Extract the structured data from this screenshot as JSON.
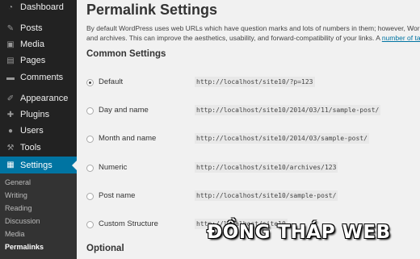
{
  "sidebar": {
    "items": [
      {
        "label": "Dashboard",
        "icon": "dashboard-icon",
        "glyph": "◔"
      },
      {
        "label": "Posts",
        "icon": "posts-icon",
        "glyph": "✎"
      },
      {
        "label": "Media",
        "icon": "media-icon",
        "glyph": "▣"
      },
      {
        "label": "Pages",
        "icon": "pages-icon",
        "glyph": "▤"
      },
      {
        "label": "Comments",
        "icon": "comments-icon",
        "glyph": "▬"
      },
      {
        "label": "Appearance",
        "icon": "appearance-icon",
        "glyph": "✐"
      },
      {
        "label": "Plugins",
        "icon": "plugins-icon",
        "glyph": "✚"
      },
      {
        "label": "Users",
        "icon": "users-icon",
        "glyph": "●"
      },
      {
        "label": "Tools",
        "icon": "tools-icon",
        "glyph": "⚒"
      },
      {
        "label": "Settings",
        "icon": "settings-icon",
        "glyph": "▦",
        "active": true
      }
    ],
    "submenu": [
      {
        "label": "General"
      },
      {
        "label": "Writing"
      },
      {
        "label": "Reading"
      },
      {
        "label": "Discussion"
      },
      {
        "label": "Media"
      },
      {
        "label": "Permalinks",
        "current": true
      }
    ]
  },
  "main": {
    "title": "Permalink Settings",
    "description_line1": "By default WordPress uses web URLs which have question marks and lots of numbers in them; however, WordPress",
    "description_line2_text": "and archives. This can improve the aesthetics, usability, and forward-compatibility of your links. A ",
    "description_link": "number of tags are",
    "common_settings_heading": "Common Settings",
    "optional_heading": "Optional",
    "options": [
      {
        "label": "Default",
        "example": "http://localhost/site10/?p=123",
        "checked": true
      },
      {
        "label": "Day and name",
        "example": "http://localhost/site10/2014/03/11/sample-post/",
        "checked": false
      },
      {
        "label": "Month and name",
        "example": "http://localhost/site10/2014/03/sample-post/",
        "checked": false
      },
      {
        "label": "Numeric",
        "example": "http://localhost/site10/archives/123",
        "checked": false
      },
      {
        "label": "Post name",
        "example": "http://localhost/site10/sample-post/",
        "checked": false
      },
      {
        "label": "Custom Structure",
        "example": "http://localhost/site10",
        "checked": false
      }
    ]
  },
  "colors": {
    "sidebar_bg": "#222222",
    "active_menu": "#0074a2",
    "link": "#0074a2",
    "page_bg": "#f1f1f1"
  },
  "watermark": "ĐỒNG THÁP WEB"
}
